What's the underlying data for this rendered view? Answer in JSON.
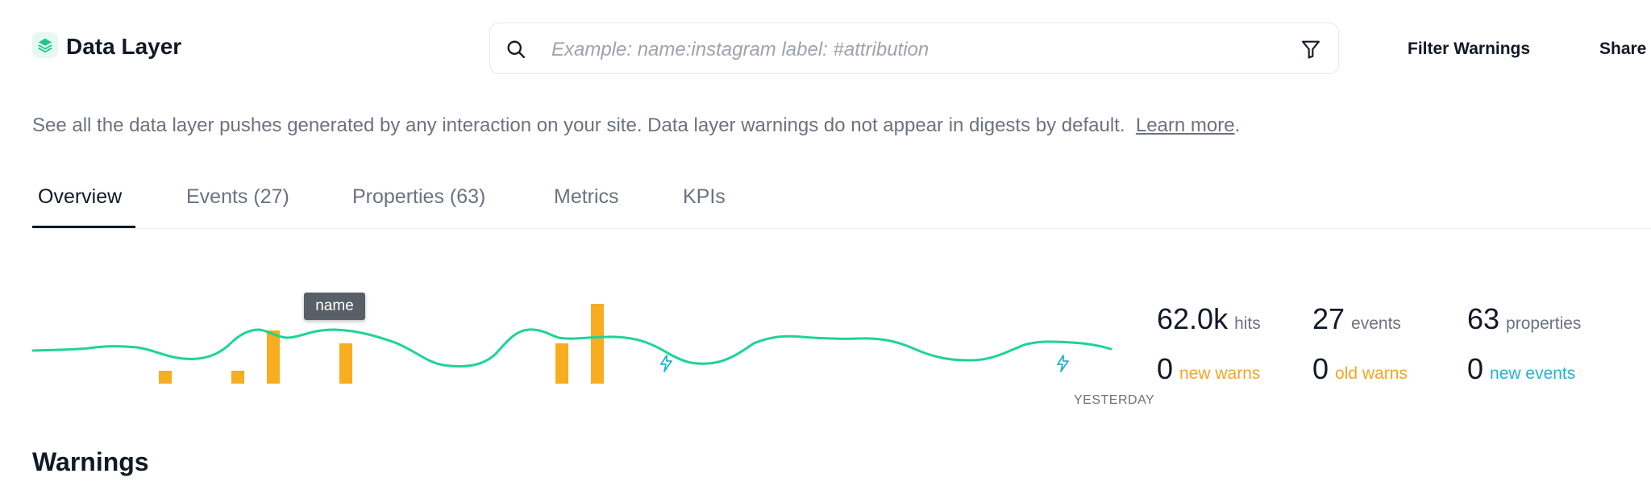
{
  "header": {
    "title": "Data Layer",
    "logo_icon": "layers-icon",
    "search_placeholder": "Example: name:instagram label: #attribution",
    "filter_warnings_label": "Filter Warnings",
    "share_label": "Share"
  },
  "description": {
    "text": "See all the data layer pushes generated by any interaction on your site. Data layer warnings do not appear in digests by default.",
    "link": "Learn more",
    "suffix": "."
  },
  "tabs": [
    {
      "label": "Overview",
      "active": true
    },
    {
      "label": "Events (27)",
      "active": false
    },
    {
      "label": "Properties (63)",
      "active": false
    },
    {
      "label": "Metrics",
      "active": false
    },
    {
      "label": "KPIs",
      "active": false
    }
  ],
  "chart": {
    "tooltip": "name",
    "x_label": "YESTERDAY",
    "colors": {
      "line": "#1ed39b",
      "bars": "#f8ac1f",
      "bolt": "#1fb5d0"
    }
  },
  "stats": {
    "hits": {
      "value": "62.0k",
      "label": "hits"
    },
    "events": {
      "value": "27",
      "label": "events"
    },
    "properties": {
      "value": "63",
      "label": "properties"
    },
    "new_warns": {
      "value": "0",
      "label": "new warns"
    },
    "old_warns": {
      "value": "0",
      "label": "old warns"
    },
    "new_events": {
      "value": "0",
      "label": "new events"
    }
  },
  "warnings_title": "Warnings"
}
